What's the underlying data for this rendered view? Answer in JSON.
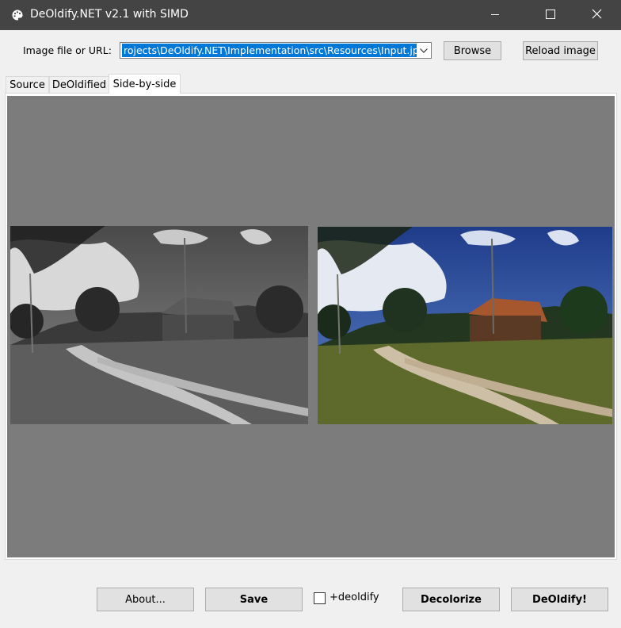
{
  "window": {
    "title": "DeOldify.NET v2.1 with SIMD"
  },
  "file_row": {
    "label": "Image file or URL:",
    "path": "rojects\\DeOldify.NET\\Implementation\\src\\Resources\\Input.jpg",
    "browse_label": "Browse",
    "reload_label": "Reload image"
  },
  "tabs": [
    {
      "label": "Source"
    },
    {
      "label": "DeOldified"
    },
    {
      "label": "Side-by-side",
      "active": true
    }
  ],
  "images": {
    "source": {
      "mode": "grayscale"
    },
    "result": {
      "mode": "colorized"
    }
  },
  "footer": {
    "about_label": "About...",
    "save_label": "Save",
    "checkbox_label": "+deoldify",
    "checkbox_checked": false,
    "decolorize_label": "Decolorize",
    "deoldify_label": "DeOldify!"
  },
  "icons": [
    "palette-icon",
    "minimize-icon",
    "maximize-icon",
    "close-icon",
    "chevron-down-icon"
  ]
}
